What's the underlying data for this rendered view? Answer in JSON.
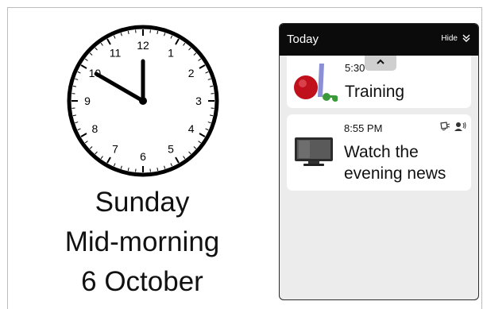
{
  "clock": {
    "hour": 10,
    "minute": 0,
    "numbers": [
      "12",
      "1",
      "2",
      "3",
      "4",
      "5",
      "6",
      "7",
      "8",
      "9",
      "10",
      "11"
    ]
  },
  "date_display": {
    "weekday": "Sunday",
    "period": "Mid-morning",
    "date": "6 October"
  },
  "today_panel": {
    "title": "Today",
    "hide_label": "Hide",
    "activities": [
      {
        "time": "5:30",
        "title": "Training",
        "icon": "dumbbells-ball-icon"
      },
      {
        "time": "8:55 PM",
        "title": "Watch the evening news",
        "icon": "tv-icon",
        "status_icons": [
          "alarm-icon",
          "person-speaking-icon"
        ]
      }
    ]
  },
  "colors": {
    "header_bg": "#0b0b0b",
    "panel_bg": "#ececec",
    "card_bg": "#ffffff"
  }
}
